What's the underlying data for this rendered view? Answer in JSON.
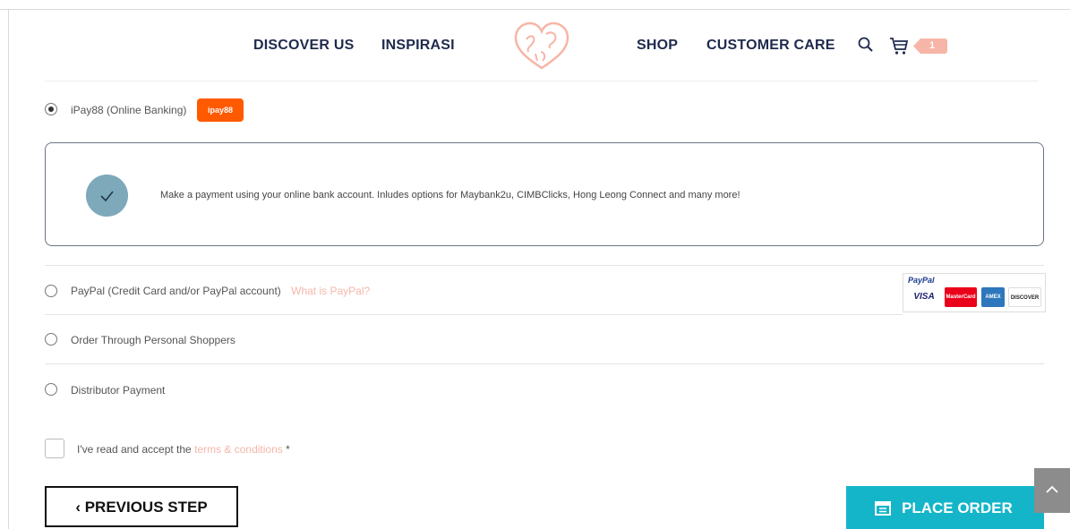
{
  "nav": {
    "discover": "DISCOVER US",
    "inspirasi": "INSPIRASI",
    "shop": "SHOP",
    "customer_care": "CUSTOMER CARE",
    "cart_count": "1",
    "logo_alt": "Sayap Gelda logo"
  },
  "payment": {
    "ipay": {
      "label": "iPay88 (Online Banking)",
      "badge": "ipay88",
      "selected": true
    },
    "ipay_description": "Make a payment using your online bank account. Inludes options for Maybank2u, CIMBClicks, Hong Leong Connect and many more!",
    "paypal": {
      "label": "PayPal (Credit Card and/or PayPal account)",
      "link": "What is PayPal?"
    },
    "paypal_logos": {
      "title": "PayPal",
      "cards": [
        "VISA",
        "MasterCard",
        "AMEX",
        "DISCOVER"
      ]
    },
    "personal_shoppers": {
      "label": "Order Through Personal Shoppers"
    },
    "distributor": {
      "label": "Distributor Payment"
    }
  },
  "terms": {
    "prefix": "I've read and accept the",
    "link": "terms & conditions",
    "required": "*"
  },
  "buttons": {
    "previous": "‹  PREVIOUS STEP",
    "place_order": "PLACE ORDER"
  },
  "colors": {
    "accent": "#14b5c9",
    "link_pink": "#f4b7a9",
    "nav_text": "#1f2a4d",
    "ipay_orange": "#ff5a00"
  }
}
